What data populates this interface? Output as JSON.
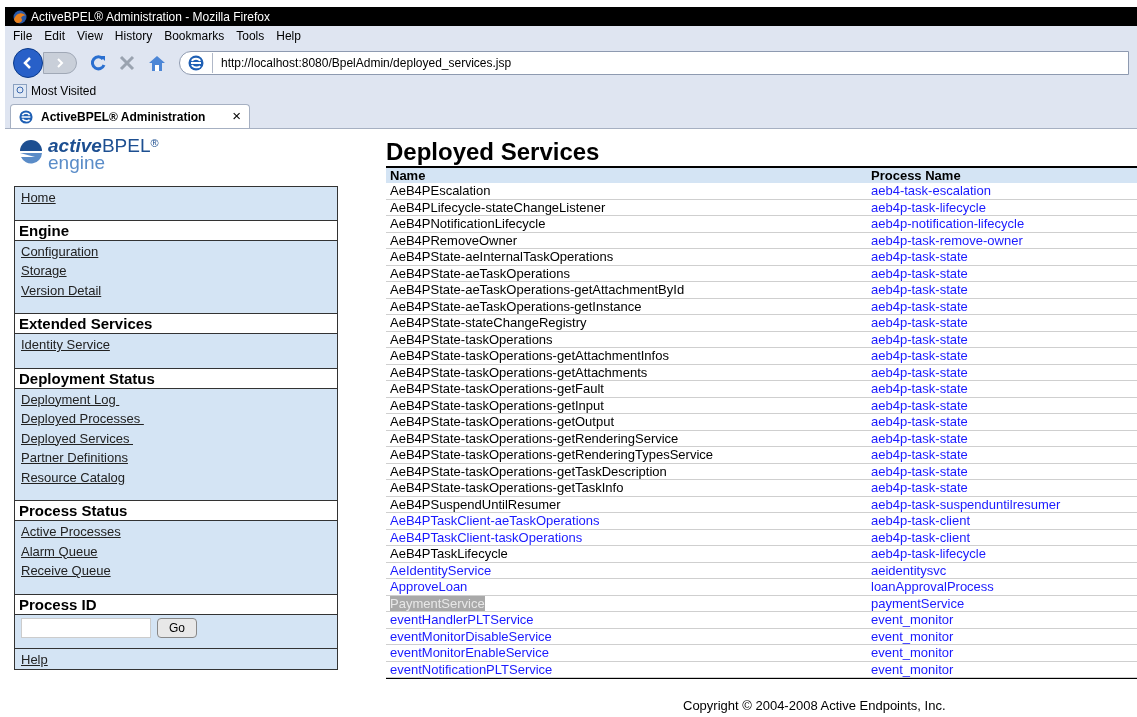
{
  "window": {
    "title": "ActiveBPEL® Administration - Mozilla Firefox"
  },
  "menu": [
    "File",
    "Edit",
    "View",
    "History",
    "Bookmarks",
    "Tools",
    "Help"
  ],
  "address": {
    "value": "http://localhost:8080/BpelAdmin/deployed_services.jsp"
  },
  "bookmarks": [
    "Most Visited"
  ],
  "tabs": [
    {
      "label": "ActiveBPEL® Administration",
      "selected": true,
      "close": "×"
    }
  ],
  "logo": {
    "word1": "active",
    "word2": "BPEL",
    "mark": "®",
    "word3": "engine"
  },
  "sidebar": [
    {
      "links": [
        "Home"
      ]
    },
    {
      "heading": "Engine",
      "links": [
        "Configuration",
        "Storage",
        "Version Detail"
      ]
    },
    {
      "heading": "Extended Services",
      "links": [
        "Identity Service"
      ]
    },
    {
      "heading": "Deployment Status",
      "links": [
        "Deployment Log ",
        "Deployed Processes ",
        "Deployed Services ",
        "Partner Definitions",
        "Resource Catalog"
      ]
    },
    {
      "heading": "Process Status",
      "links": [
        "Active Processes",
        "Alarm Queue",
        "Receive Queue"
      ]
    },
    {
      "heading": "Process ID",
      "kind": "form",
      "button": "Go"
    },
    {
      "links": [
        "Help"
      ]
    }
  ],
  "page_title": "Deployed Services",
  "table": {
    "columns": [
      "Name",
      "Process Name"
    ],
    "rows": [
      {
        "name": "AeB4PEscalation",
        "link": false,
        "selected": false,
        "process": "aeb4-task-escalation"
      },
      {
        "name": "AeB4PLifecycle-stateChangeListener",
        "link": false,
        "selected": false,
        "process": "aeb4p-task-lifecycle"
      },
      {
        "name": "AeB4PNotificationLifecycle",
        "link": false,
        "selected": false,
        "process": "aeb4p-notification-lifecycle"
      },
      {
        "name": "AeB4PRemoveOwner",
        "link": false,
        "selected": false,
        "process": "aeb4p-task-remove-owner"
      },
      {
        "name": "AeB4PState-aeInternalTaskOperations",
        "link": false,
        "selected": false,
        "process": "aeb4p-task-state"
      },
      {
        "name": "AeB4PState-aeTaskOperations",
        "link": false,
        "selected": false,
        "process": "aeb4p-task-state"
      },
      {
        "name": "AeB4PState-aeTaskOperations-getAttachmentById",
        "link": false,
        "selected": false,
        "process": "aeb4p-task-state"
      },
      {
        "name": "AeB4PState-aeTaskOperations-getInstance",
        "link": false,
        "selected": false,
        "process": "aeb4p-task-state"
      },
      {
        "name": "AeB4PState-stateChangeRegistry",
        "link": false,
        "selected": false,
        "process": "aeb4p-task-state"
      },
      {
        "name": "AeB4PState-taskOperations",
        "link": false,
        "selected": false,
        "process": "aeb4p-task-state"
      },
      {
        "name": "AeB4PState-taskOperations-getAttachmentInfos",
        "link": false,
        "selected": false,
        "process": "aeb4p-task-state"
      },
      {
        "name": "AeB4PState-taskOperations-getAttachments",
        "link": false,
        "selected": false,
        "process": "aeb4p-task-state"
      },
      {
        "name": "AeB4PState-taskOperations-getFault",
        "link": false,
        "selected": false,
        "process": "aeb4p-task-state"
      },
      {
        "name": "AeB4PState-taskOperations-getInput",
        "link": false,
        "selected": false,
        "process": "aeb4p-task-state"
      },
      {
        "name": "AeB4PState-taskOperations-getOutput",
        "link": false,
        "selected": false,
        "process": "aeb4p-task-state"
      },
      {
        "name": "AeB4PState-taskOperations-getRenderingService",
        "link": false,
        "selected": false,
        "process": "aeb4p-task-state"
      },
      {
        "name": "AeB4PState-taskOperations-getRenderingTypesService",
        "link": false,
        "selected": false,
        "process": "aeb4p-task-state"
      },
      {
        "name": "AeB4PState-taskOperations-getTaskDescription",
        "link": false,
        "selected": false,
        "process": "aeb4p-task-state"
      },
      {
        "name": "AeB4PState-taskOperations-getTaskInfo",
        "link": false,
        "selected": false,
        "process": "aeb4p-task-state"
      },
      {
        "name": "AeB4PSuspendUntilResumer",
        "link": false,
        "selected": false,
        "process": "aeb4p-task-suspenduntilresumer"
      },
      {
        "name": "AeB4PTaskClient-aeTaskOperations",
        "link": true,
        "selected": false,
        "process": "aeb4p-task-client"
      },
      {
        "name": "AeB4PTaskClient-taskOperations",
        "link": true,
        "selected": false,
        "process": "aeb4p-task-client"
      },
      {
        "name": "AeB4PTaskLifecycle",
        "link": false,
        "selected": false,
        "process": "aeb4p-task-lifecycle"
      },
      {
        "name": "AeIdentityService",
        "link": true,
        "selected": false,
        "process": "aeidentitysvc"
      },
      {
        "name": "ApproveLoan",
        "link": true,
        "selected": false,
        "process": "loanApprovalProcess"
      },
      {
        "name": "PaymentService",
        "link": true,
        "selected": true,
        "process": "paymentService"
      },
      {
        "name": "eventHandlerPLTService",
        "link": true,
        "selected": false,
        "process": "event_monitor"
      },
      {
        "name": "eventMonitorDisableService",
        "link": true,
        "selected": false,
        "process": "event_monitor"
      },
      {
        "name": "eventMonitorEnableService",
        "link": true,
        "selected": false,
        "process": "event_monitor"
      },
      {
        "name": "eventNotificationPLTService",
        "link": true,
        "selected": false,
        "process": "event_monitor"
      }
    ]
  },
  "footer": "Copyright © 2004-2008 Active Endpoints, Inc."
}
